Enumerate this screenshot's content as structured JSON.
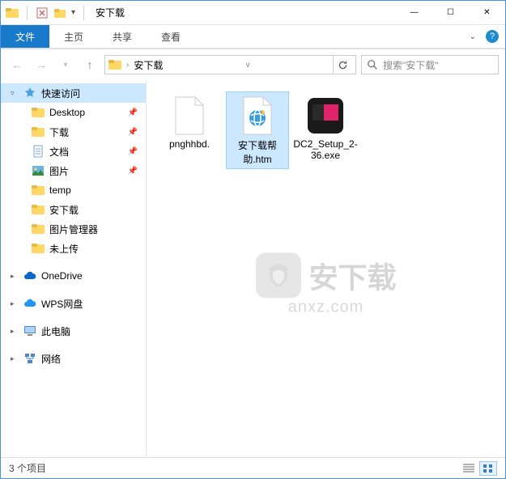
{
  "titlebar": {
    "title": "安下载",
    "minimize": "—",
    "maximize": "☐",
    "close": "✕"
  },
  "ribbon": {
    "file": "文件",
    "home": "主页",
    "share": "共享",
    "view": "查看"
  },
  "address": {
    "path_segment": "安下载",
    "search_placeholder": "搜索\"安下载\""
  },
  "sidebar": {
    "quick_access": "快速访问",
    "items": [
      {
        "label": "Desktop",
        "icon": "folder",
        "pinned": true
      },
      {
        "label": "下载",
        "icon": "folder",
        "pinned": true
      },
      {
        "label": "文档",
        "icon": "document",
        "pinned": true
      },
      {
        "label": "图片",
        "icon": "pictures",
        "pinned": true
      },
      {
        "label": "temp",
        "icon": "folder",
        "pinned": false
      },
      {
        "label": "安下载",
        "icon": "folder",
        "pinned": false
      },
      {
        "label": "图片管理器",
        "icon": "folder",
        "pinned": false
      },
      {
        "label": "未上传",
        "icon": "folder",
        "pinned": false
      }
    ],
    "onedrive": "OneDrive",
    "wps": "WPS网盘",
    "thispc": "此电脑",
    "network": "网络"
  },
  "files": [
    {
      "name": "pnghhbd.",
      "type": "blank",
      "selected": false
    },
    {
      "name": "安下载帮助.htm",
      "type": "htm",
      "selected": true
    },
    {
      "name": "DC2_Setup_2-36.exe",
      "type": "exe",
      "selected": false
    }
  ],
  "watermark": {
    "text": "安下载",
    "sub": "anxz.com"
  },
  "status": {
    "count": "3 个项目"
  }
}
